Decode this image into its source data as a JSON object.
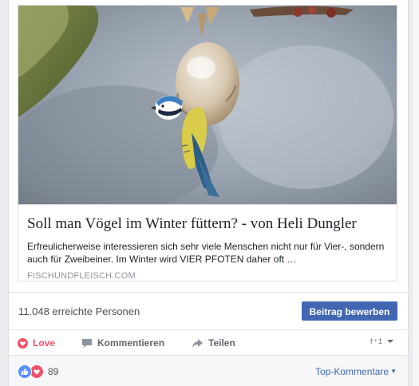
{
  "link": {
    "title": "Soll man Vögel im Winter füttern? - von Heli Dungler",
    "description": "Erfreulicherweise interessieren sich sehr viele Menschen nicht nur für Vier-, sondern auch für Zweibeiner. Im Winter wird VIER PFOTEN daher oft …",
    "domain": "FISCHUNDFLEISCH.COM"
  },
  "reach": {
    "text": "11.048 erreichte Personen",
    "boost_label": "Beitrag bewerben"
  },
  "actions": {
    "love_label": "Love",
    "comment_label": "Kommentieren",
    "share_label": "Teilen"
  },
  "footer": {
    "reaction_count": "89",
    "sort_label": "Top-Kommentare"
  },
  "colors": {
    "primary": "#4267b2",
    "love": "#f25268",
    "like": "#5890ff"
  }
}
